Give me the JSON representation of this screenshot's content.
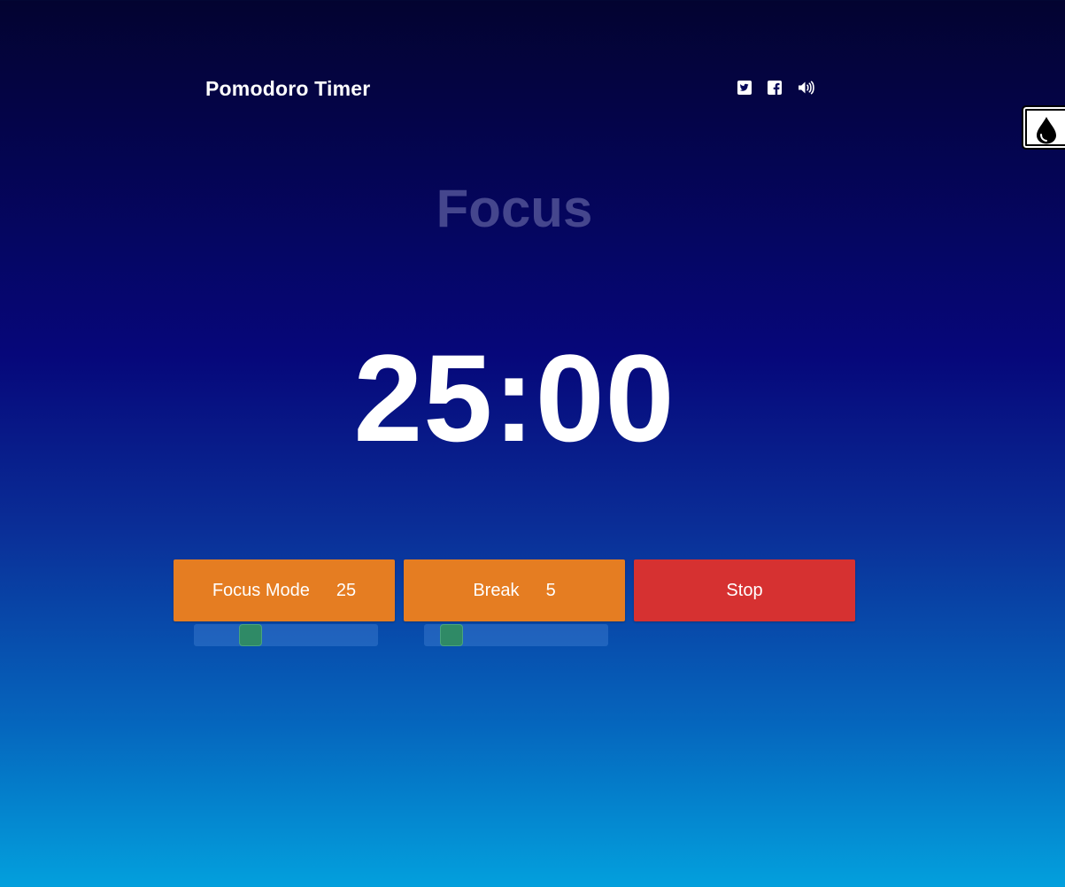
{
  "header": {
    "title": "Pomodoro Timer",
    "icons": [
      "twitter-icon",
      "facebook-icon",
      "volume-icon"
    ]
  },
  "theme_toggle": {
    "icon": "drop-icon"
  },
  "mode": {
    "label": "Focus"
  },
  "timer": {
    "display": "25:00"
  },
  "controls": {
    "focus": {
      "label": "Focus Mode",
      "value": "25"
    },
    "break": {
      "label": "Break",
      "value": "5"
    },
    "stop": {
      "label": "Stop"
    }
  },
  "sliders": {
    "focus": {
      "value": 25,
      "fill_fraction": 0.28
    },
    "break": {
      "value": 5,
      "fill_fraction": 0.1
    }
  },
  "colors": {
    "accent_orange": "#e57d22",
    "stop_red": "#d63131",
    "slider_thumb": "#2f8a66",
    "mode_label": "#45468d"
  }
}
